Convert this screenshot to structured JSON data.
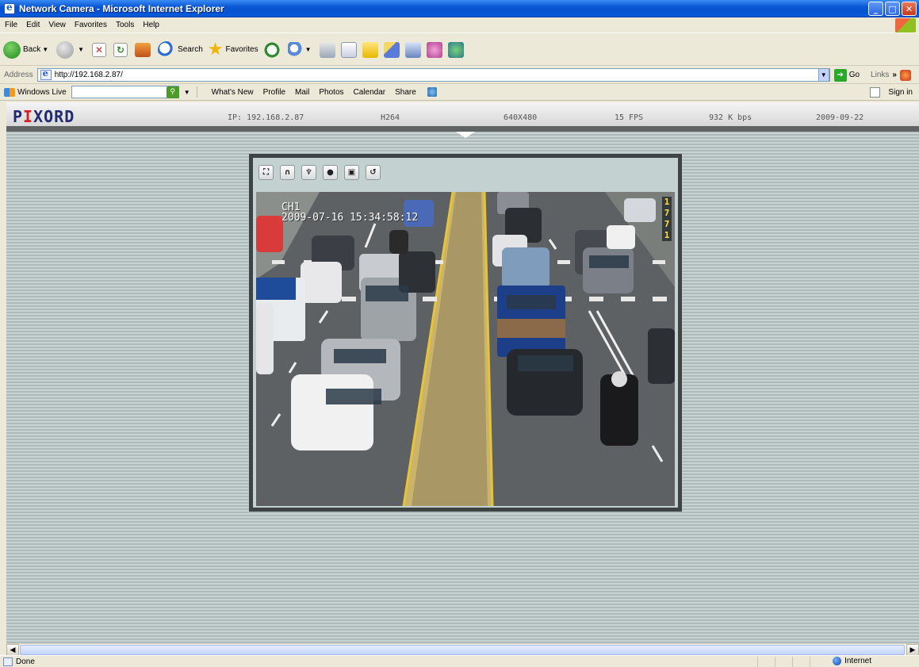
{
  "window": {
    "title": "Network Camera - Microsoft Internet Explorer",
    "minimize": "_",
    "maximize": "□",
    "close": "✕"
  },
  "menu": [
    "File",
    "Edit",
    "View",
    "Favorites",
    "Tools",
    "Help"
  ],
  "toolbar": {
    "back": "Back",
    "search": "Search",
    "favorites": "Favorites"
  },
  "address": {
    "label": "Address",
    "url": "http://192.168.2.87/",
    "go": "Go",
    "links": "Links",
    "chevron": "»"
  },
  "livebar": {
    "brand": "Windows Live",
    "items": [
      "What's New",
      "Profile",
      "Mail",
      "Photos",
      "Calendar",
      "Share"
    ],
    "signin": "Sign in"
  },
  "camera": {
    "logo_a": "PI",
    "logo_b": "XORD",
    "ip": "IP: 192.168.2.87",
    "codec": "H264",
    "resolution": "640X480",
    "fps": "15 FPS",
    "bitrate": "932 K bps",
    "date": "2009-09-22",
    "controls": [
      "fullscreen-icon",
      "headphones-icon",
      "microphone-icon",
      "record-icon",
      "snapshot-icon",
      "rotate-icon"
    ],
    "osd_channel": "CH1",
    "osd_timestamp": "2009-07-16 15:34:58:12",
    "osd_side": "1 7 7 1"
  },
  "status": {
    "text": "Done",
    "zone": "Internet"
  }
}
